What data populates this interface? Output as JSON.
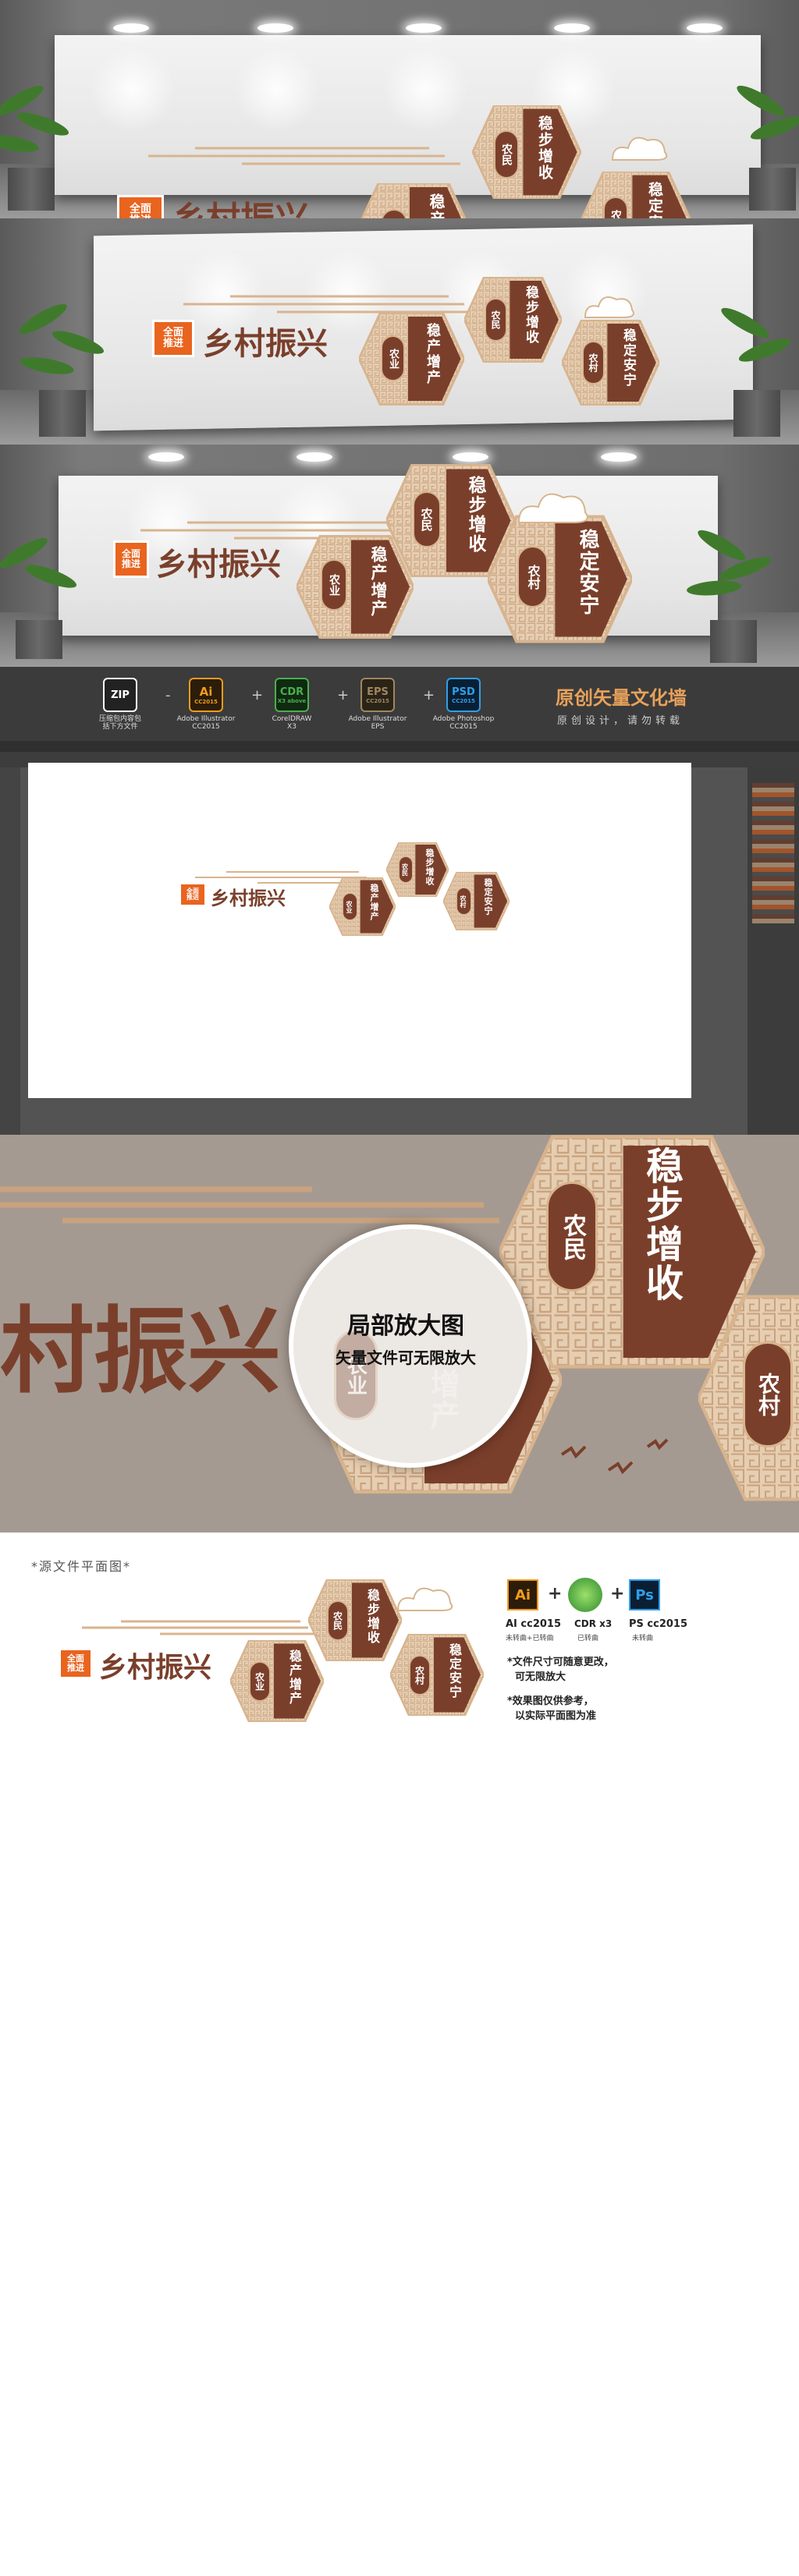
{
  "design": {
    "badge": "全面推进",
    "badge_line1": "全面",
    "badge_line2": "推进",
    "title": "乡村振兴",
    "hex1_pill": "农业",
    "hex1_text": "稳产增产",
    "hex2_pill": "农民",
    "hex2_text": "稳步增收",
    "hex3_pill": "农村",
    "hex3_text": "稳定安宁"
  },
  "formats": {
    "zip": {
      "icon": "ZIP",
      "label1": "压缩包内容包",
      "label2": "括下方文件"
    },
    "ai": {
      "icon": "Ai",
      "version": "CC2015",
      "label1": "Adobe Illustrator",
      "label2": "CC2015"
    },
    "cdr": {
      "icon": "CDR",
      "version": "X3 above",
      "label1": "CorelDRAW",
      "label2": "X3"
    },
    "eps": {
      "icon": "EPS",
      "version": "CC2015",
      "label1": "Adobe Illustrator",
      "label2": "EPS"
    },
    "psd": {
      "icon": "PSD",
      "version": "CC2015",
      "label1": "Adobe Photoshop",
      "label2": "CC2015"
    },
    "dash": "-",
    "plus": "+"
  },
  "promo": {
    "heading": "原创矢量文化墙",
    "sub": "原创设计，请勿转载"
  },
  "zoom": {
    "line1": "局部放大图",
    "line2": "矢量文件可无限放大",
    "title_partial": "村振兴",
    "hex1_pill": "农业",
    "hex1_partial": "增产",
    "hex2_pill": "农民",
    "hex2_text": "稳步增收",
    "hex3_pill": "农村"
  },
  "source": {
    "caption": "*源文件平面图*",
    "ai_label": "AI cc2015",
    "ai_note": "未转曲+已转曲",
    "cdr_label": "CDR x3",
    "cdr_note": "已转曲",
    "ps_label": "PS cc2015",
    "ps_note": "未转曲",
    "note1a": "*文件尺寸可随意更改，",
    "note1b": "可无限放大",
    "note2a": "*效果图仅供参考，",
    "note2b": "以实际平面图为准",
    "ai_icon": "Ai",
    "ps_icon": "Ps"
  },
  "colors": {
    "brown": "#7a3f2b",
    "tan": "#d8b48e",
    "orange": "#e8641f"
  }
}
